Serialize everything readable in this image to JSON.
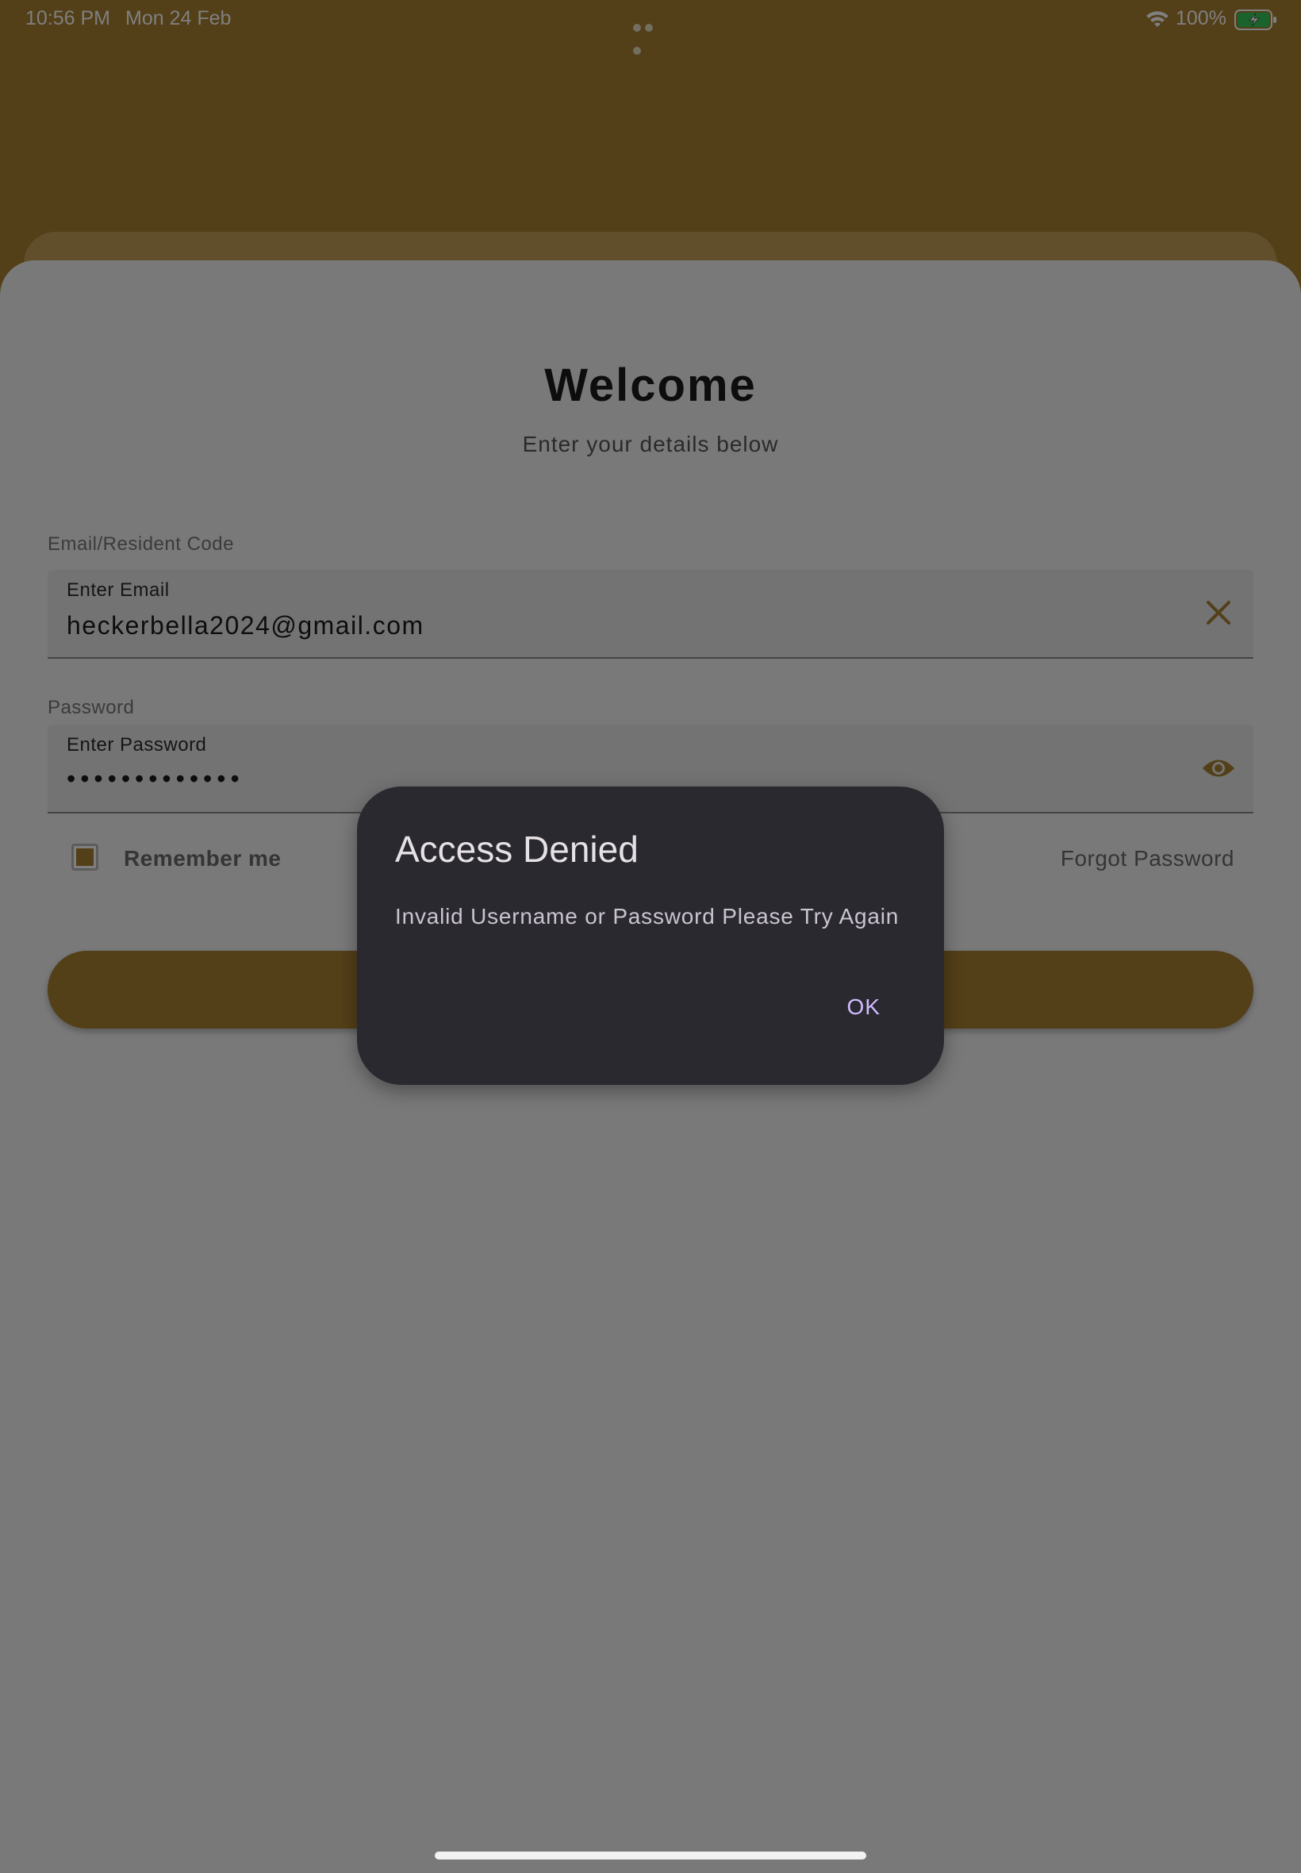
{
  "status_bar": {
    "time": "10:56 PM",
    "date": "Mon 24 Feb",
    "battery_percent": "100%",
    "icons": [
      "wifi-icon",
      "battery-charging-icon",
      "multitask-dots-icon"
    ]
  },
  "login": {
    "title": "Welcome",
    "subtitle": "Enter your details below",
    "email_section_label": "Email/Resident Code",
    "email_field_label": "Enter Email",
    "email_value": "heckerbella2024@gmail.com",
    "password_section_label": "Password",
    "password_field_label": "Enter Password",
    "password_value": "•••••••••••••",
    "remember_label": "Remember me",
    "remember_checked": true,
    "forgot_label": "Forgot Password",
    "icons": [
      "clear-icon",
      "eye-icon"
    ]
  },
  "dialog": {
    "title": "Access Denied",
    "message": "Invalid Username or Password Please Try Again",
    "ok_label": "OK"
  },
  "colors": {
    "brand": "#a67f30",
    "sheet": "#f2f2f2",
    "dialog_bg": "#2b2930",
    "dialog_action": "#d0bcff"
  }
}
